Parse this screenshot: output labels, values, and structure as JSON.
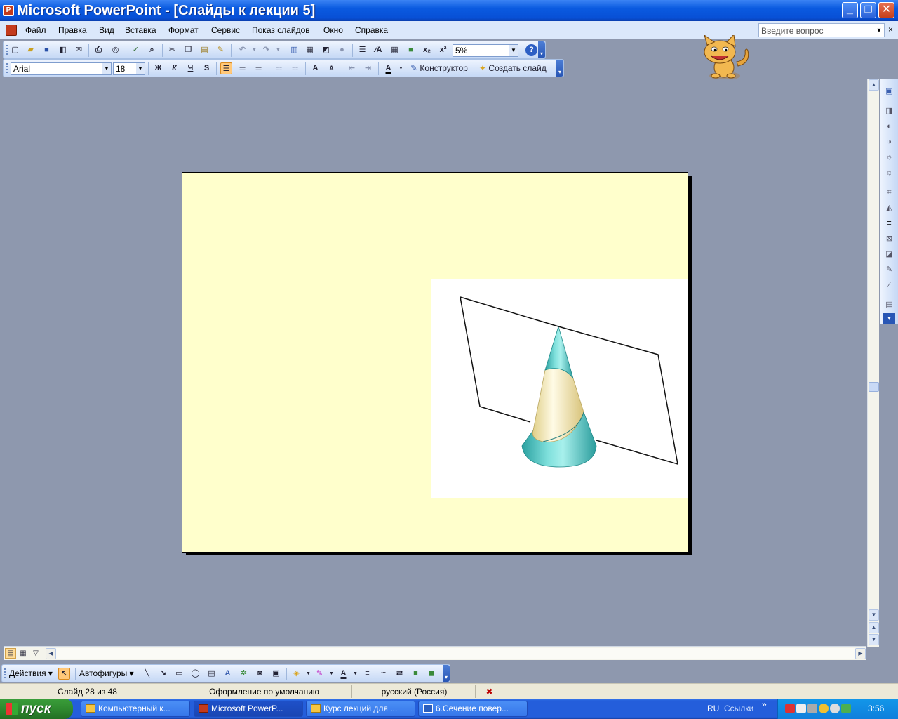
{
  "window": {
    "title": "Microsoft PowerPoint - [Слайды к лекции 5]",
    "app_icon": "powerpoint-icon",
    "buttons": {
      "minimize": "_",
      "maximize": "❐",
      "close": "✕"
    }
  },
  "menu": {
    "items": [
      "Файл",
      "Правка",
      "Вид",
      "Вставка",
      "Формат",
      "Сервис",
      "Показ слайдов",
      "Окно",
      "Справка"
    ],
    "help_placeholder": "Введите вопрос",
    "doc_close": "×"
  },
  "standard_toolbar": {
    "zoom": "5%",
    "subscript": "x₂",
    "superscript": "x²",
    "help": "?"
  },
  "formatting_toolbar": {
    "font_name": "Arial",
    "font_size": "18",
    "bold": "Ж",
    "italic": "К",
    "underline": "Ч",
    "shadow": "S",
    "grow_font": "A",
    "shrink_font": "A",
    "font_color": "A",
    "designer_label": "Конструктор",
    "new_slide_label": "Создать слайд"
  },
  "drawing_toolbar": {
    "actions_label": "Действия",
    "autoshapes_label": "Автофигуры"
  },
  "status": {
    "slide": "Слайд 28 из 48",
    "design": "Оформление по умолчанию",
    "language": "русский (Россия)"
  },
  "taskbar": {
    "start_label": "пуск",
    "tasks": [
      {
        "label": "Компьютерный к...",
        "icon": "folder-icon"
      },
      {
        "label": "Microsoft PowerP...",
        "icon": "powerpoint-icon"
      },
      {
        "label": "Курс лекций для ...",
        "icon": "folder-icon"
      },
      {
        "label": "6.Сечение повер...",
        "icon": "word-icon"
      }
    ],
    "lang": "RU",
    "links": "Ссылки",
    "chevron": "»",
    "clock": "3:56"
  },
  "colors": {
    "slide_background": "#ffffcc",
    "workspace": "#8e98ae",
    "cone_teal": "#3fb8b8",
    "section_cream": "#f5eab8"
  }
}
